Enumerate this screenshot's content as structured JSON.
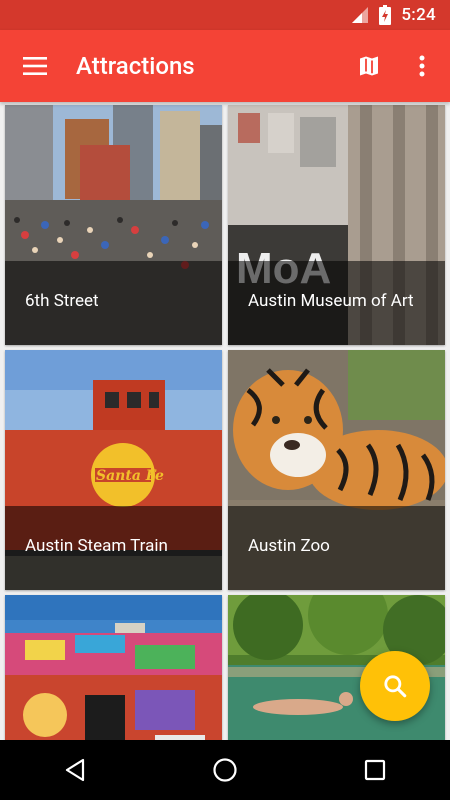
{
  "status_bar": {
    "time": "5:24",
    "icons": [
      "signal-icon",
      "battery-charging-icon"
    ]
  },
  "app_bar": {
    "title": "Attractions",
    "menu_icon": "menu-icon",
    "map_icon": "map-icon",
    "more_icon": "more-vert-icon"
  },
  "attractions": [
    {
      "name": "6th Street"
    },
    {
      "name": "Austin Museum of Art"
    },
    {
      "name": "Austin Steam Train"
    },
    {
      "name": "Austin Zoo"
    },
    {
      "name": ""
    },
    {
      "name": ""
    }
  ],
  "fab": {
    "icon": "search-icon"
  },
  "nav_bar": {
    "icons": [
      "back-icon",
      "home-icon",
      "recents-icon"
    ]
  },
  "colors": {
    "primary": "#f44336",
    "primary_dark": "#d4382c",
    "accent": "#ffc107"
  }
}
